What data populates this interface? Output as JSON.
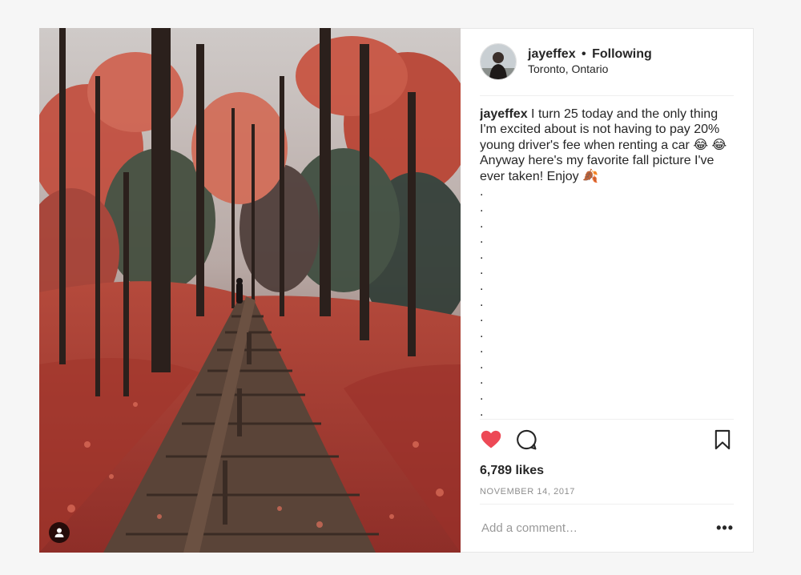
{
  "post": {
    "username": "jayeffex",
    "separator": "•",
    "follow_status": "Following",
    "location": "Toronto, Ontario",
    "caption_user": "jayeffex",
    "caption_text": "I turn 25 today and the only thing I'm excited about is not having to pay 20% young driver's fee when renting a car 😂 😂 Anyway here's my favorite fall picture I've ever taken! Enjoy 🍂",
    "caption_dots": ".\n.\n.\n.\n.\n.\n.\n.\n.\n.\n.\n.\n.\n.\n.",
    "likes": "6,789 likes",
    "date": "NOVEMBER 14, 2017",
    "comment_placeholder": "Add a comment…",
    "more_label": "•••"
  },
  "colors": {
    "like_red": "#ed4956",
    "text": "#262626",
    "muted": "#8e8e8e"
  },
  "icons": {
    "like": "heart-icon",
    "comment": "comment-icon",
    "save": "bookmark-icon",
    "tag": "user-tag-icon"
  }
}
